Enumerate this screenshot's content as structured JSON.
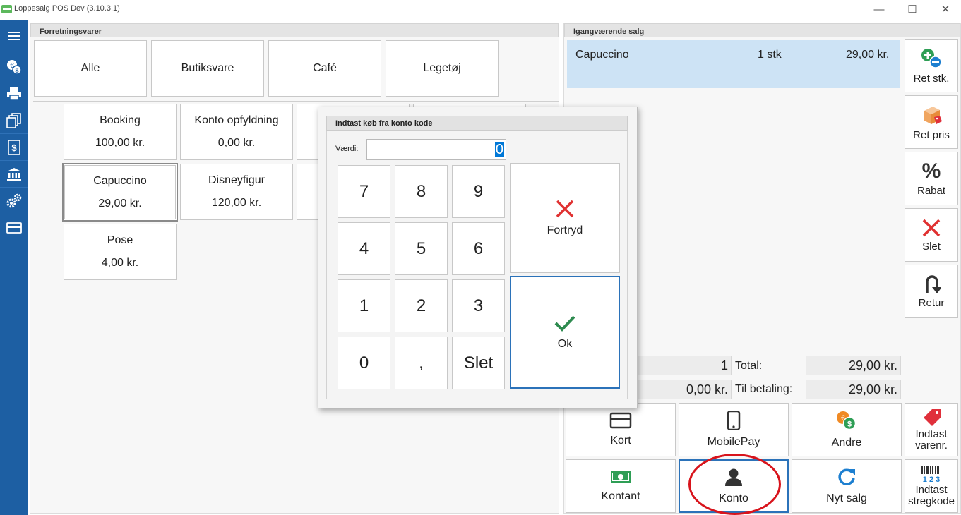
{
  "window": {
    "title": "Loppesalg POS  Dev (3.10.3.1)",
    "minimize": "—",
    "maximize": "☐",
    "close": "✕"
  },
  "sidebar": {
    "items": [
      {
        "icon": "menu-icon"
      },
      {
        "icon": "currency-icon"
      },
      {
        "icon": "printer-icon"
      },
      {
        "icon": "copy-pages-icon"
      },
      {
        "icon": "dollar-document-icon"
      },
      {
        "icon": "bank-icon"
      },
      {
        "icon": "settings-gears-icon"
      },
      {
        "icon": "card-icon"
      }
    ]
  },
  "left_panel": {
    "title": "Forretningsvarer",
    "categories": [
      "Alle",
      "Butiksvare",
      "Café",
      "Legetøj"
    ],
    "products": [
      {
        "name": "Booking",
        "price": "100,00 kr."
      },
      {
        "name": "Konto opfyldning",
        "price": "0,00 kr."
      },
      {
        "name": "Capuccino",
        "price": "29,00 kr."
      },
      {
        "name": "Disneyfigur",
        "price": "120,00 kr."
      },
      {
        "name": "Pose",
        "price": "4,00 kr."
      }
    ]
  },
  "right_panel": {
    "title": "Igangværende salg",
    "sale_lines": [
      {
        "name": "Capuccino",
        "qty": "1 stk",
        "amount": "29,00 kr."
      }
    ],
    "actions": [
      {
        "label": "Ret stk.",
        "icon": "plus-minus-icon"
      },
      {
        "label": "Ret pris",
        "icon": "price-tag-box-icon"
      },
      {
        "label": "Rabat",
        "icon": "percent-icon"
      },
      {
        "label": "Slet",
        "icon": "delete-x-icon"
      },
      {
        "label": "Retur",
        "icon": "return-arrow-icon"
      }
    ],
    "totals": {
      "count": "1",
      "total_label": "Total:",
      "total_value": "29,00 kr.",
      "paid": "0,00 kr.",
      "due_label": "Til betaling:",
      "due_value": "29,00 kr."
    },
    "payments": [
      {
        "label": "Kort",
        "icon": "card-icon"
      },
      {
        "label": "MobilePay",
        "icon": "phone-icon"
      },
      {
        "label": "Andre",
        "icon": "coins-icon"
      },
      {
        "label": "Indtast varenr.",
        "line1": "Indtast",
        "line2": "varenr.",
        "icon": "tag-icon"
      },
      {
        "label": "Kontant",
        "icon": "cash-icon"
      },
      {
        "label": "Konto",
        "icon": "user-icon"
      },
      {
        "label": "Nyt salg",
        "icon": "refresh-icon"
      },
      {
        "label": "Indtast stregkode",
        "line1": "Indtast",
        "line2": "stregkode",
        "icon": "barcode-icon",
        "barcode_text": "1 2 3"
      }
    ]
  },
  "dialog": {
    "title": "Indtast køb fra konto kode",
    "field_label": "Værdi:",
    "field_value": "0",
    "keys": [
      "7",
      "8",
      "9",
      "4",
      "5",
      "6",
      "1",
      "2",
      "3",
      "0",
      ",",
      "Slet"
    ],
    "cancel_label": "Fortryd",
    "ok_label": "Ok"
  },
  "colors": {
    "sidebar": "#1d5fa3",
    "selected_line": "#cde3f5",
    "accent_border": "#2b72b9",
    "cancel_red": "#e03131",
    "ok_green": "#2e8b4f",
    "annotation_red": "#d8141c"
  }
}
